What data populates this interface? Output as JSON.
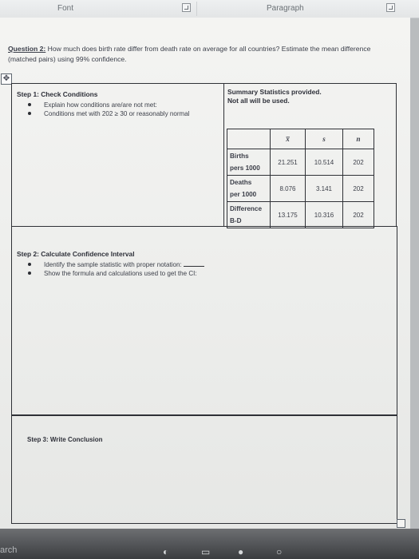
{
  "ribbon": {
    "groups": [
      "Font",
      "Paragraph"
    ]
  },
  "question": {
    "label": "Question 2:",
    "text": " How much does birth rate differ from death rate on average for all countries? Estimate the mean difference (matched pairs) using 99% confidence."
  },
  "step1": {
    "title": "Step 1: Check Conditions",
    "bullets": [
      "Explain how conditions are/are not met:",
      "Conditions met with 202 ≥ 30 or reasonably normal"
    ]
  },
  "summary": {
    "title_line1": "Summary Statistics provided.",
    "title_line2": "Not all will be used.",
    "columns": [
      "x̅",
      "s",
      "n"
    ],
    "rows": [
      {
        "label_line1": "Births",
        "label_line2": "pers 1000",
        "mean": "21.251",
        "sd": "10.514",
        "n": "202"
      },
      {
        "label_line1": "Deaths",
        "label_line2": "per 1000",
        "mean": "8.076",
        "sd": "3.141",
        "n": "202"
      },
      {
        "label_line1": "Difference",
        "label_line2": "B-D",
        "mean": "13.175",
        "sd": "10.316",
        "n": "202"
      }
    ]
  },
  "step2": {
    "title": "Step 2: Calculate Confidence Interval",
    "bullets": [
      "Identify the sample statistic with proper notation:",
      "Show the formula and calculations used to get the CI:"
    ]
  },
  "step3": {
    "title": "Step 3: Write Conclusion"
  },
  "taskbar": {
    "search_fragment": "arch"
  }
}
